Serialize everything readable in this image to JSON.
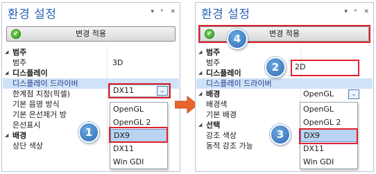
{
  "colors": {
    "title": "#2b63b5",
    "callout": "#2f6db5",
    "highlight_box": "#e0202a",
    "apply_icon": "#2e9a20"
  },
  "window_controls": [
    "▾",
    "ᵖ",
    "✕"
  ],
  "left": {
    "title": "환경 설정",
    "apply_button": "변경 적용",
    "rows": [
      {
        "type": "cat",
        "label": "범주"
      },
      {
        "type": "prop",
        "label": "범주",
        "value": "3D"
      },
      {
        "type": "cat",
        "label": "디스플레이"
      },
      {
        "type": "prop",
        "label": "디스플레이 드라이버",
        "value": ""
      },
      {
        "type": "prop",
        "label": "한계점 지정(픽셀)",
        "value": ""
      },
      {
        "type": "prop",
        "label": "기본 음영 방식",
        "value": ""
      },
      {
        "type": "prop",
        "label": "기본 은선제거 방",
        "value": ""
      },
      {
        "type": "prop",
        "label": "은선표시",
        "value": ""
      },
      {
        "type": "cat",
        "label": "배경"
      },
      {
        "type": "prop",
        "label": "상단 색상",
        "value": ""
      }
    ],
    "combo_value": "DX11",
    "dropdown_options": [
      "OpenGL",
      "OpenGL 2",
      "DX9",
      "DX11",
      "Win GDI"
    ],
    "highlighted_option": "DX9",
    "callout": "1"
  },
  "right": {
    "title": "환경 설정",
    "apply_button": "변경 적용",
    "rows": [
      {
        "type": "cat",
        "label": "범주"
      },
      {
        "type": "prop",
        "label": "범주",
        "value": ""
      },
      {
        "type": "cat",
        "label": "디스플레이"
      },
      {
        "type": "prop",
        "label": "디스플레이 드라이버",
        "value": ""
      },
      {
        "type": "cat",
        "label": "배경"
      },
      {
        "type": "prop",
        "label": "배경색",
        "value": ""
      },
      {
        "type": "prop",
        "label": "기본 배경",
        "value": ""
      },
      {
        "type": "cat",
        "label": "선택"
      },
      {
        "type": "prop",
        "label": "강조 색상",
        "value": ""
      },
      {
        "type": "prop",
        "label": "동적 강조 가능",
        "value": ""
      }
    ],
    "category_value": "2D",
    "combo_value": "OpenGL",
    "dropdown_options": [
      "OpenGL",
      "OpenGL 2",
      "DX9",
      "DX11",
      "Win GDI"
    ],
    "highlighted_option": "DX9",
    "callouts": [
      "2",
      "3",
      "4"
    ]
  }
}
